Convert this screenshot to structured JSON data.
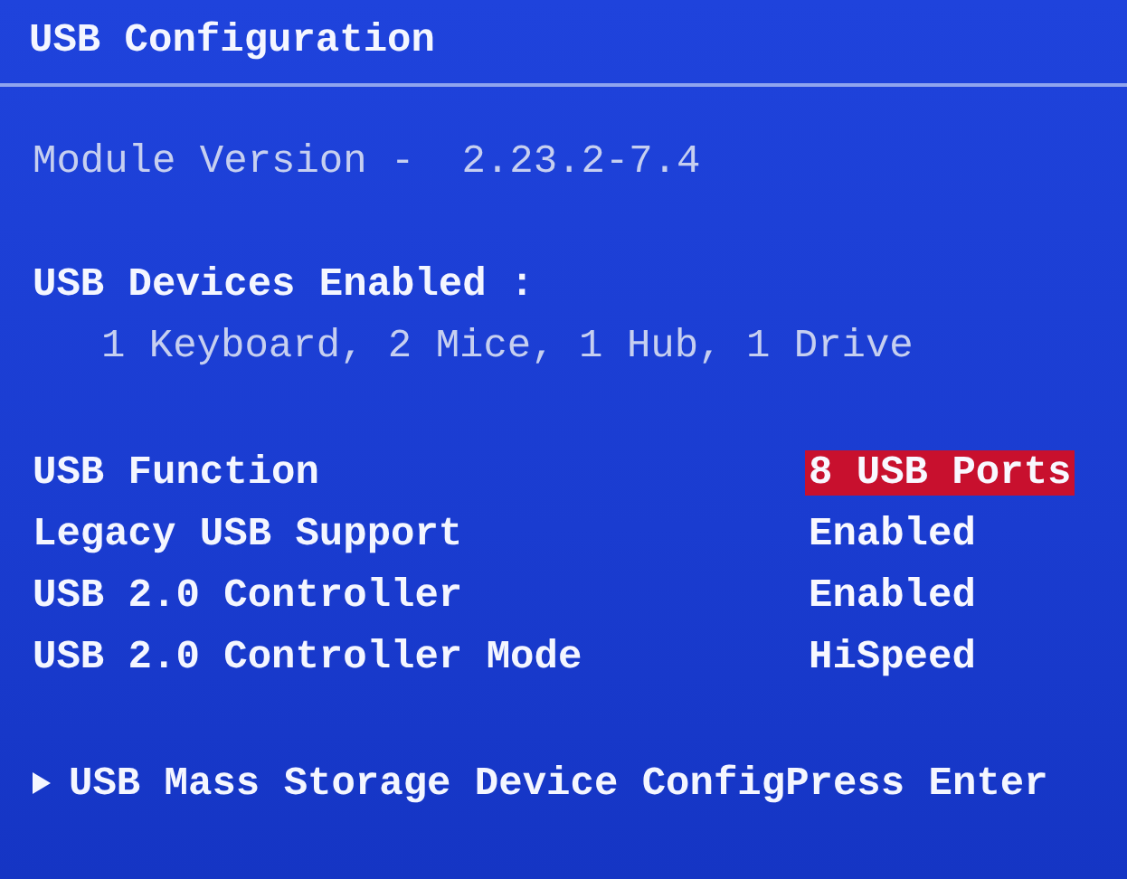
{
  "title": "USB Configuration",
  "module_version": {
    "label": "Module Version -",
    "value": "2.23.2-7.4"
  },
  "devices": {
    "label": "USB Devices Enabled :",
    "value": "1 Keyboard, 2 Mice, 1 Hub, 1 Drive"
  },
  "settings": [
    {
      "label": "USB Function",
      "value": "8 USB Ports",
      "selected": true
    },
    {
      "label": "Legacy USB Support",
      "value": "Enabled",
      "selected": false
    },
    {
      "label": "USB 2.0 Controller",
      "value": "Enabled",
      "selected": false
    },
    {
      "label": "USB 2.0 Controller Mode",
      "value": "HiSpeed",
      "selected": false
    }
  ],
  "submenu": {
    "label": "USB Mass Storage Device Config",
    "help": "Press Enter"
  }
}
